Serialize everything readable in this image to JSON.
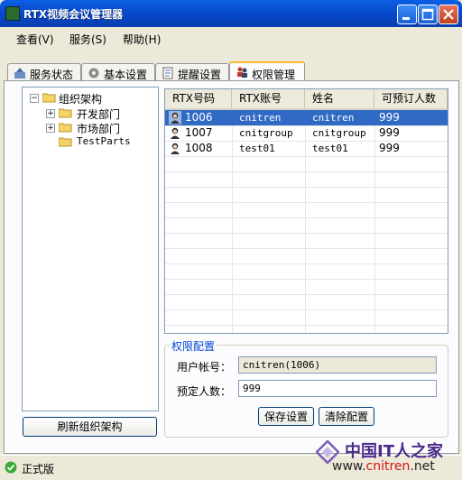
{
  "window": {
    "title": "RTX视频会议管理器"
  },
  "menu": {
    "items": [
      "查看(V)",
      "服务(S)",
      "帮助(H)"
    ]
  },
  "tabs": [
    {
      "label": "服务状态",
      "icon": "service-icon",
      "active": false
    },
    {
      "label": "基本设置",
      "icon": "settings-icon",
      "active": false
    },
    {
      "label": "提醒设置",
      "icon": "reminder-icon",
      "active": false
    },
    {
      "label": "权限管理",
      "icon": "permission-icon",
      "active": true
    }
  ],
  "tree": {
    "root": "组织架构",
    "children": [
      {
        "label": "开发部门",
        "expandable": true
      },
      {
        "label": "市场部门",
        "expandable": true
      },
      {
        "label": "TestParts",
        "expandable": false
      }
    ]
  },
  "refresh_button": "刷新组织架构",
  "table": {
    "columns": [
      "RTX号码",
      "RTX账号",
      "姓名",
      "可预订人数"
    ],
    "rows": [
      {
        "cells": [
          "1006",
          "cnitren",
          "cnitren",
          "999"
        ],
        "selected": true
      },
      {
        "cells": [
          "1007",
          "cnitgroup",
          "cnitgroup",
          "999"
        ],
        "selected": false
      },
      {
        "cells": [
          "1008",
          "test01",
          "test01",
          "999"
        ],
        "selected": false
      }
    ]
  },
  "permission_config": {
    "title": "权限配置",
    "account_label": "用户帐号：",
    "account_value": "cnitren(1006)",
    "quota_label": "预定人数：",
    "quota_value": "999",
    "save_button": "保存设置",
    "clear_button": "清除配置"
  },
  "status": {
    "text": "正式版"
  },
  "watermark": {
    "cn": "中国IT人之家",
    "url_prefix": "www.",
    "url_brand": "cnitren",
    "url_suffix": ".net"
  },
  "colors": {
    "selection": "#316AC5",
    "titlebar": "#0A5FE4",
    "group_title": "#0046D5"
  }
}
